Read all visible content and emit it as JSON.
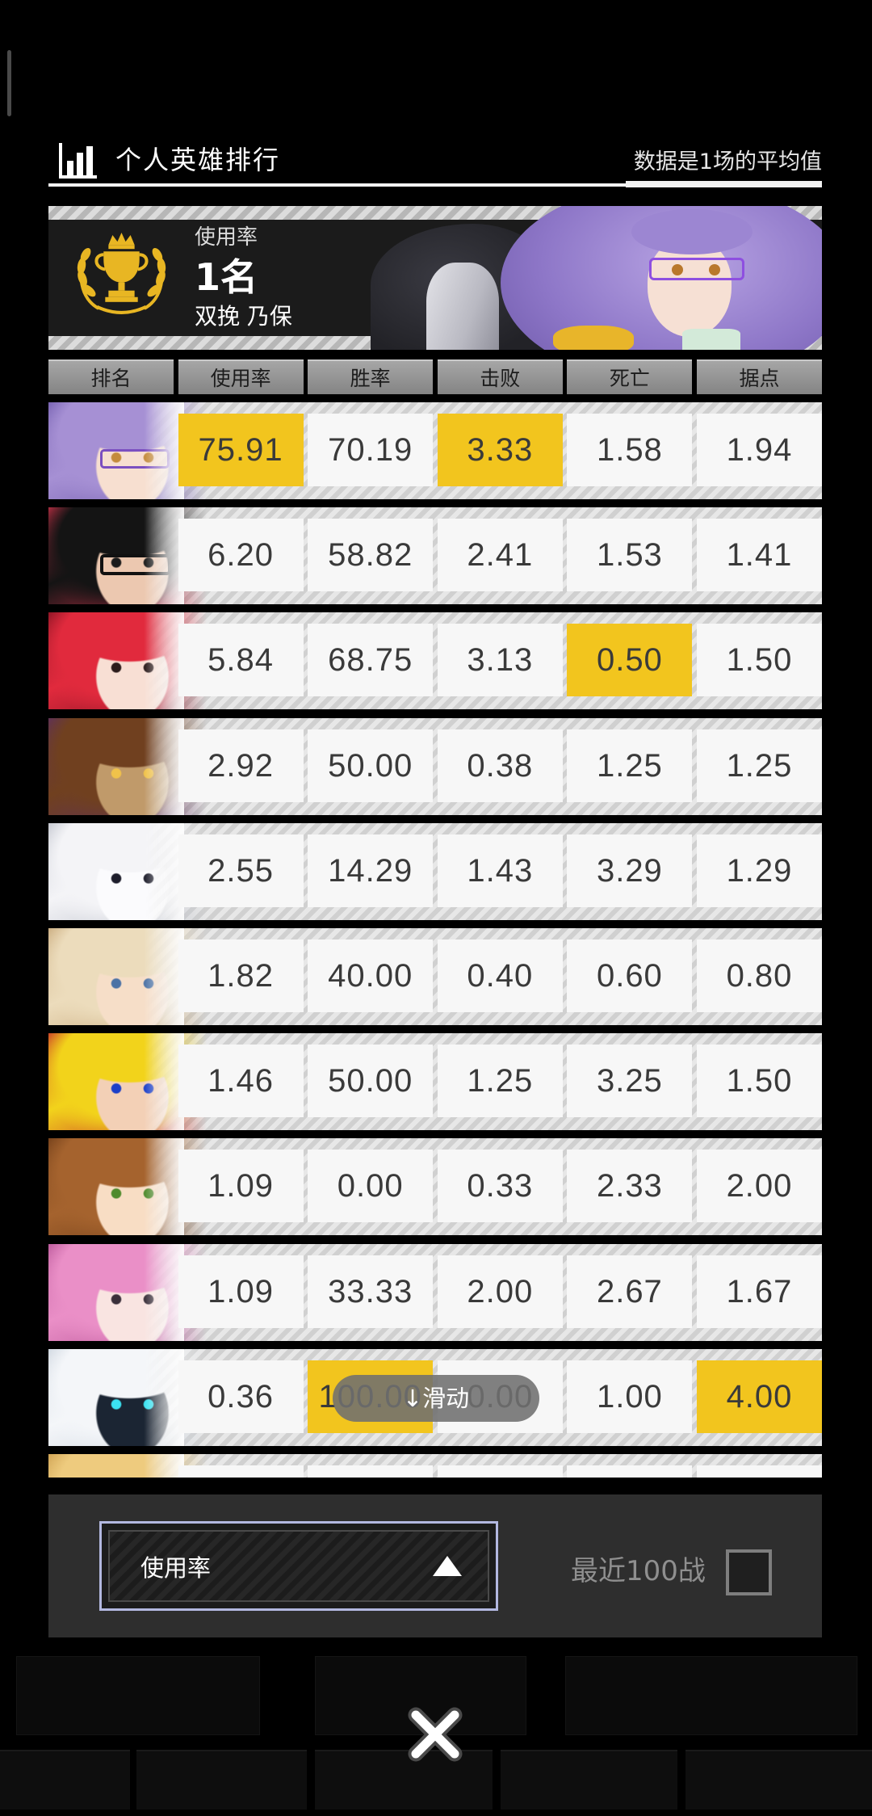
{
  "header": {
    "title": "个人英雄排行",
    "note": "数据是1场的平均值",
    "icon": "bar-chart-icon"
  },
  "banner": {
    "stat_label": "使用率",
    "rank": "1名",
    "hero_name": "双挽 乃保",
    "icon": "trophy-icon"
  },
  "table": {
    "columns": [
      "排名",
      "使用率",
      "胜率",
      "击败",
      "死亡",
      "据点"
    ],
    "rows": [
      {
        "values": [
          "75.91",
          "70.19",
          "3.33",
          "1.58",
          "1.94"
        ],
        "highlight": [
          0,
          2
        ]
      },
      {
        "values": [
          "6.20",
          "58.82",
          "2.41",
          "1.53",
          "1.41"
        ],
        "highlight": []
      },
      {
        "values": [
          "5.84",
          "68.75",
          "3.13",
          "0.50",
          "1.50"
        ],
        "highlight": [
          3
        ]
      },
      {
        "values": [
          "2.92",
          "50.00",
          "0.38",
          "1.25",
          "1.25"
        ],
        "highlight": []
      },
      {
        "values": [
          "2.55",
          "14.29",
          "1.43",
          "3.29",
          "1.29"
        ],
        "highlight": []
      },
      {
        "values": [
          "1.82",
          "40.00",
          "0.40",
          "0.60",
          "0.80"
        ],
        "highlight": []
      },
      {
        "values": [
          "1.46",
          "50.00",
          "1.25",
          "3.25",
          "1.50"
        ],
        "highlight": []
      },
      {
        "values": [
          "1.09",
          "0.00",
          "0.33",
          "2.33",
          "2.00"
        ],
        "highlight": []
      },
      {
        "values": [
          "1.09",
          "33.33",
          "2.00",
          "2.67",
          "1.67"
        ],
        "highlight": []
      },
      {
        "values": [
          "0.36",
          "100.00",
          "0.00",
          "1.00",
          "4.00"
        ],
        "highlight": [
          1,
          4
        ]
      }
    ]
  },
  "swipe_hint": "↓滑动",
  "footer": {
    "sort_select": {
      "selected": "使用率",
      "icon": "triangle-up-icon"
    },
    "recent_filter": {
      "label": "最近100战",
      "checked": false
    }
  },
  "close_icon": "close-icon",
  "colors": {
    "highlight": "#F2C51E",
    "background": "#000000",
    "panel": "#2E2E2E",
    "select_border": "#B3B8E0"
  }
}
